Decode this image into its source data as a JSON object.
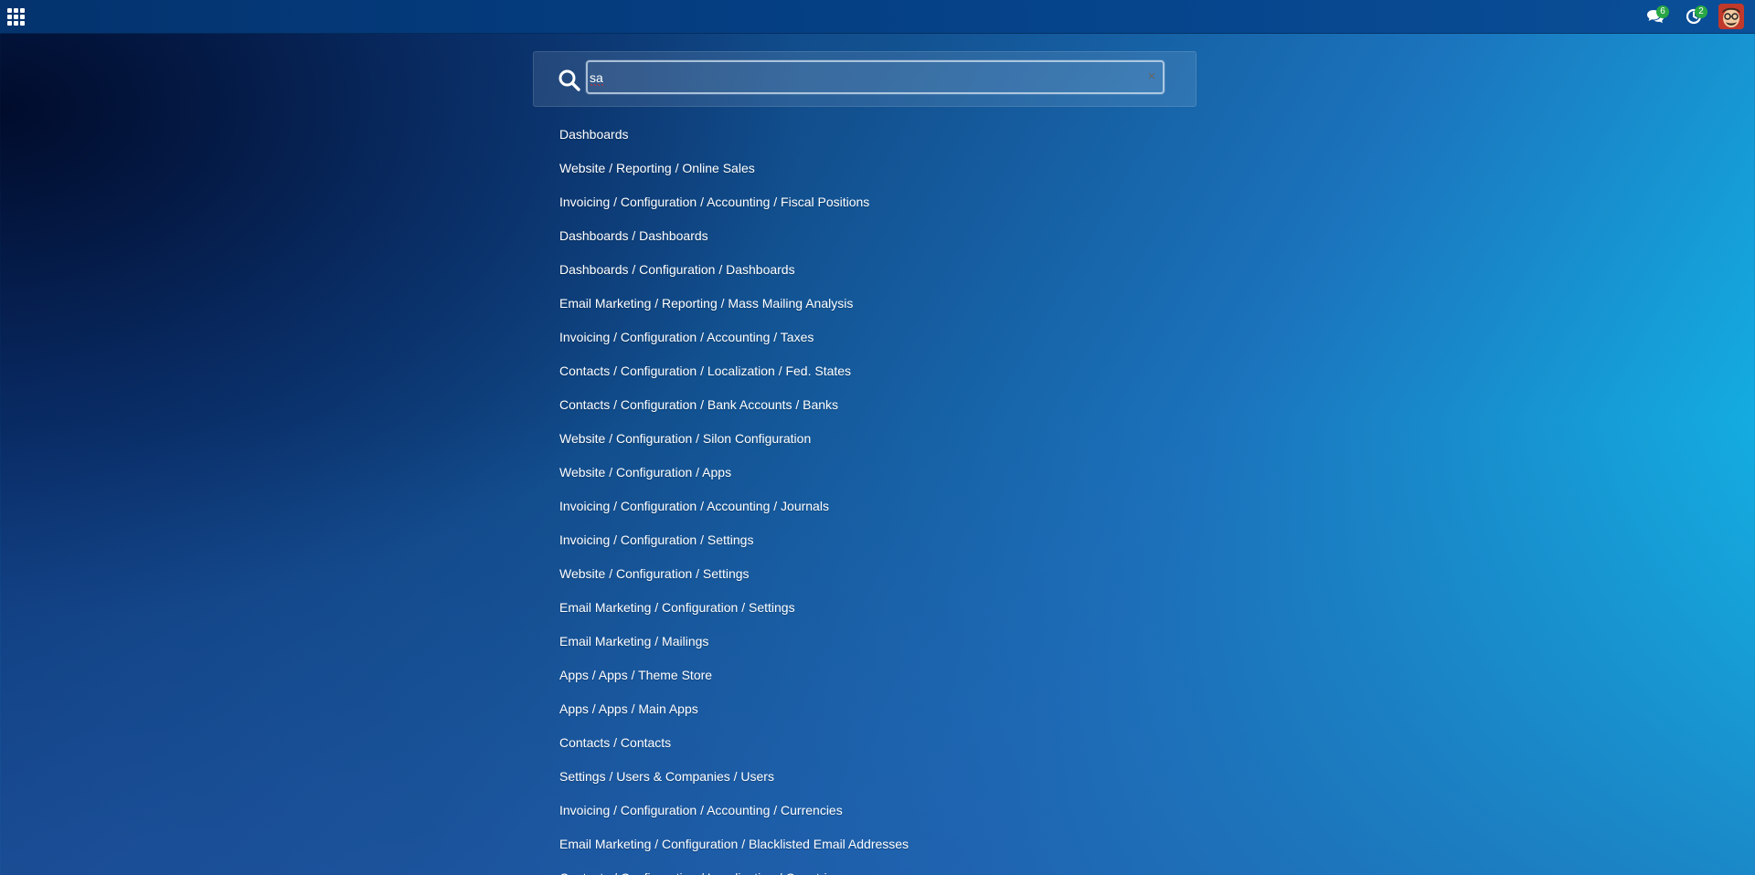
{
  "topbar": {
    "apps_icon": "grid-icon",
    "messages": {
      "icon": "chat-icon",
      "count": "6"
    },
    "activities": {
      "icon": "clock-icon",
      "count": "2"
    },
    "avatar_icon": "user-avatar"
  },
  "search": {
    "icon": "search-icon",
    "value": "sa",
    "clear_icon": "×"
  },
  "results": [
    "Dashboards",
    "Website / Reporting / Online Sales",
    "Invoicing / Configuration / Accounting / Fiscal Positions",
    "Dashboards / Dashboards",
    "Dashboards / Configuration / Dashboards",
    "Email Marketing / Reporting / Mass Mailing Analysis",
    "Invoicing / Configuration / Accounting / Taxes",
    "Contacts / Configuration / Localization / Fed. States",
    "Contacts / Configuration / Bank Accounts / Banks",
    "Website / Configuration / Silon Configuration",
    "Website / Configuration / Apps",
    "Invoicing / Configuration / Accounting / Journals",
    "Invoicing / Configuration / Settings",
    "Website / Configuration / Settings",
    "Email Marketing / Configuration / Settings",
    "Email Marketing / Mailings",
    "Apps / Apps / Theme Store",
    "Apps / Apps / Main Apps",
    "Contacts / Contacts",
    "Settings / Users & Companies / Users",
    "Invoicing / Configuration / Accounting / Currencies",
    "Email Marketing / Configuration / Blacklisted Email Addresses",
    "Contacts / Configuration / Localization / Countries"
  ],
  "colors": {
    "badge": "#28a745",
    "topbar": "#05438a",
    "text": "#ffffff"
  }
}
